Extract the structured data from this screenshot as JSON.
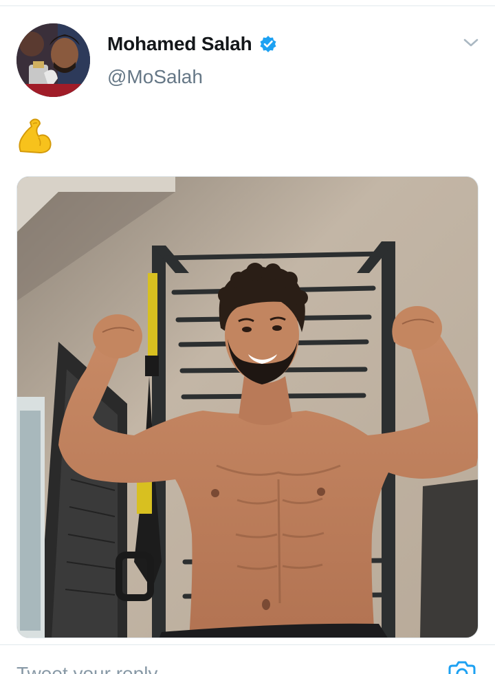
{
  "tweet": {
    "author": {
      "display_name": "Mohamed Salah",
      "handle": "@MoSalah",
      "verified": true,
      "avatar_icon": "profile-photo"
    },
    "text_emoji": "💪",
    "media": {
      "type": "photo",
      "description_icon": "tweet-photo"
    },
    "menu_icon": "chevron-down-icon"
  },
  "reply": {
    "placeholder": "Tweet your reply",
    "camera_icon": "camera-icon"
  },
  "colors": {
    "verified_blue": "#1da1f2",
    "link_blue": "#1da1f2",
    "text_primary": "#14171a",
    "text_secondary": "#657786",
    "divider": "#e1e8ed"
  }
}
